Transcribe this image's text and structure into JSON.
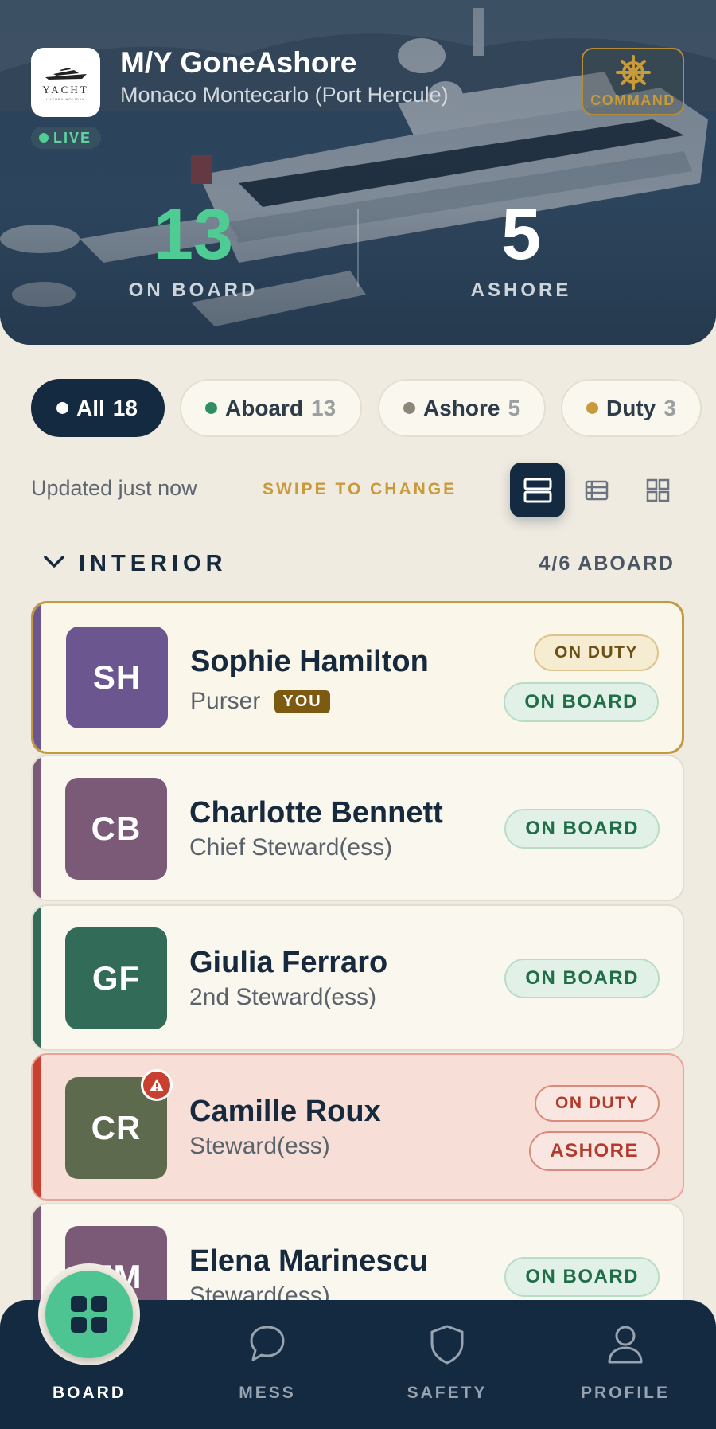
{
  "header": {
    "logo_text": "YACHT",
    "logo_subtext": "LUXURY HOLIDAY",
    "vessel_name": "M/Y GoneAshore",
    "port": "Monaco Montecarlo (Port Hercule)",
    "live_label": "LIVE",
    "command_label": "COMMAND",
    "onboard_count": "13",
    "onboard_label": "ON BOARD",
    "ashore_count": "5",
    "ashore_label": "ASHORE"
  },
  "filters": [
    {
      "label": "All",
      "count": "18",
      "selected": true
    },
    {
      "label": "Aboard",
      "count": "13"
    },
    {
      "label": "Ashore",
      "count": "5"
    },
    {
      "label": "Duty",
      "count": "3"
    }
  ],
  "toolbar": {
    "updated_text": "Updated just now",
    "swipe_hint": "SWIPE TO CHANGE",
    "view_modes": [
      "cards",
      "list",
      "grid"
    ],
    "active_view": "cards"
  },
  "section": {
    "title": "INTERIOR",
    "summary": "4/6 ABOARD"
  },
  "crew": [
    {
      "initials": "SH",
      "name": "Sophie Hamilton",
      "role": "Purser",
      "you_badge": "YOU",
      "duty": "ON DUTY",
      "status": "ON BOARD",
      "avatar_color": "#6b5690",
      "stripe_color": "#6b5690"
    },
    {
      "initials": "CB",
      "name": "Charlotte Bennett",
      "role": "Chief Steward(ess)",
      "status": "ON BOARD",
      "avatar_color": "#7b5a78",
      "stripe_color": "#7b5a78"
    },
    {
      "initials": "GF",
      "name": "Giulia Ferraro",
      "role": "2nd Steward(ess)",
      "status": "ON BOARD",
      "avatar_color": "#326b58",
      "stripe_color": "#326b58"
    },
    {
      "initials": "CR",
      "name": "Camille Roux",
      "role": "Steward(ess)",
      "duty": "ON DUTY",
      "status": "ASHORE",
      "avatar_color": "#5e6a4e",
      "stripe_color": "#c8402f",
      "alert": true
    },
    {
      "initials": "EM",
      "name": "Elena Marinescu",
      "role": "Steward(ess)",
      "status": "ON BOARD",
      "avatar_color": "#7b5a78",
      "stripe_color": "#7b5a78"
    }
  ],
  "nav": {
    "board_label": "BOARD",
    "mess_label": "MESS",
    "safety_label": "SAFETY",
    "profile_label": "PROFILE",
    "active": "BOARD"
  },
  "colors": {
    "navy": "#142a40",
    "accent_green": "#4fcc94",
    "gold": "#c99a3a",
    "alert_red": "#c8402f",
    "background": "#efebe1"
  }
}
